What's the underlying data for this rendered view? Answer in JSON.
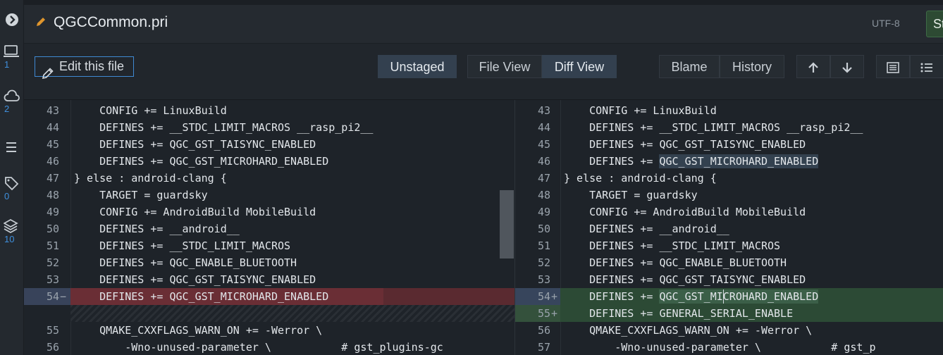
{
  "activity": [
    {
      "name": "chevron-right-icon",
      "count": ""
    },
    {
      "name": "laptop-icon",
      "count": "1"
    },
    {
      "name": "cloud-icon",
      "count": "2"
    },
    {
      "name": "menu-icon",
      "count": ""
    },
    {
      "name": "tag-icon",
      "count": "0"
    },
    {
      "name": "layers-icon",
      "count": "10"
    }
  ],
  "header": {
    "filename": "QGCCommon.pri",
    "encoding": "UTF-8",
    "stage_label": "St"
  },
  "toolbar": {
    "edit_label": "Edit this file",
    "unstaged_label": "Unstaged",
    "file_view_label": "File View",
    "diff_view_label": "Diff View",
    "blame_label": "Blame",
    "history_label": "History"
  },
  "left_lines": [
    {
      "n": "43",
      "m": "",
      "t": "    CONFIG += LinuxBuild",
      "k": ""
    },
    {
      "n": "44",
      "m": "",
      "t": "    DEFINES += __STDC_LIMIT_MACROS __rasp_pi2__",
      "k": ""
    },
    {
      "n": "45",
      "m": "",
      "t": "    DEFINES += QGC_GST_TAISYNC_ENABLED",
      "k": ""
    },
    {
      "n": "46",
      "m": "",
      "t": "    DEFINES += QGC_GST_MICROHARD_ENABLED",
      "k": ""
    },
    {
      "n": "47",
      "m": "",
      "t": "} else : android-clang {",
      "k": ""
    },
    {
      "n": "48",
      "m": "",
      "t": "    TARGET = guardsky",
      "k": ""
    },
    {
      "n": "49",
      "m": "",
      "t": "    CONFIG += AndroidBuild MobileBuild",
      "k": ""
    },
    {
      "n": "50",
      "m": "",
      "t": "    DEFINES += __android__",
      "k": ""
    },
    {
      "n": "51",
      "m": "",
      "t": "    DEFINES += __STDC_LIMIT_MACROS",
      "k": ""
    },
    {
      "n": "52",
      "m": "",
      "t": "    DEFINES += QGC_ENABLE_BLUETOOTH",
      "k": ""
    },
    {
      "n": "53",
      "m": "",
      "t": "    DEFINES += QGC_GST_TAISYNC_ENABLED",
      "k": ""
    },
    {
      "n": "54",
      "m": "−",
      "t": "    DEFINES += QGC_GST_MICROHARD_ENABLED",
      "k": "del"
    },
    {
      "n": "",
      "m": "",
      "t": "",
      "k": "hatch"
    },
    {
      "n": "55",
      "m": "",
      "t": "    QMAKE_CXXFLAGS_WARN_ON += -Werror \\",
      "k": ""
    },
    {
      "n": "56",
      "m": "",
      "t": "        -Wno-unused-parameter \\           # gst_plugins-gc",
      "k": ""
    }
  ],
  "right_lines": [
    {
      "n": "43",
      "m": "",
      "t": "    CONFIG += LinuxBuild",
      "k": ""
    },
    {
      "n": "44",
      "m": "",
      "t": "    DEFINES += __STDC_LIMIT_MACROS __rasp_pi2__",
      "k": ""
    },
    {
      "n": "45",
      "m": "",
      "t": "    DEFINES += QGC_GST_TAISYNC_ENABLED",
      "k": ""
    },
    {
      "n": "46",
      "m": "",
      "t": "    DEFINES += QGC_GST_MICROHARD_ENABLED",
      "k": "",
      "hl": "QGC_GST_MICROHARD_ENABLED"
    },
    {
      "n": "47",
      "m": "",
      "t": "} else : android-clang {",
      "k": ""
    },
    {
      "n": "48",
      "m": "",
      "t": "    TARGET = guardsky",
      "k": ""
    },
    {
      "n": "49",
      "m": "",
      "t": "    CONFIG += AndroidBuild MobileBuild",
      "k": ""
    },
    {
      "n": "50",
      "m": "",
      "t": "    DEFINES += __android__",
      "k": ""
    },
    {
      "n": "51",
      "m": "",
      "t": "    DEFINES += __STDC_LIMIT_MACROS",
      "k": ""
    },
    {
      "n": "52",
      "m": "",
      "t": "    DEFINES += QGC_ENABLE_BLUETOOTH",
      "k": ""
    },
    {
      "n": "53",
      "m": "",
      "t": "    DEFINES += QGC_GST_TAISYNC_ENABLED",
      "k": ""
    },
    {
      "n": "54",
      "m": "+",
      "t": "    DEFINES += QGC_GST_MICROHARD_ENABLED",
      "k": "add first"
    },
    {
      "n": "55",
      "m": "+",
      "t": "    DEFINES += GENERAL_SERIAL_ENABLE",
      "k": "add"
    },
    {
      "n": "56",
      "m": "",
      "t": "    QMAKE_CXXFLAGS_WARN_ON += -Werror \\",
      "k": ""
    },
    {
      "n": "57",
      "m": "",
      "t": "        -Wno-unused-parameter \\           # gst_p",
      "k": ""
    }
  ]
}
